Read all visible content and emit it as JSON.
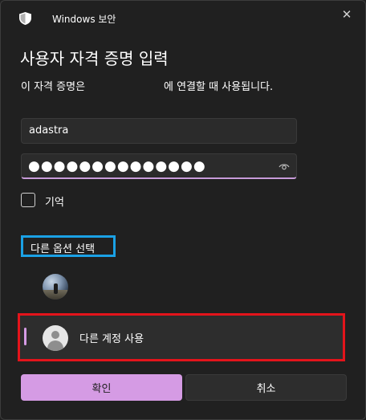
{
  "window": {
    "app_title": "Windows 보안",
    "icon": "shield-icon",
    "close_label": "✕"
  },
  "dialog": {
    "heading": "사용자 자격 증명 입력",
    "subtext_before": "이 자격 증명은",
    "subtext_after": "에 연결할 때 사용됩니다."
  },
  "form": {
    "username_value": "adastra",
    "password_mask": "●●●●●●●●●●●●●●",
    "password_reveal_icon": "eye-icon",
    "remember_label": "기억",
    "remember_checked": false
  },
  "options": {
    "more_choices_label": "다른 옵션 선택",
    "account_avatar_icon": "user-photo-icon",
    "other_account_label": "다른 계정 사용",
    "other_account_icon": "person-icon"
  },
  "buttons": {
    "ok_label": "확인",
    "cancel_label": "취소"
  },
  "colors": {
    "background": "#202020",
    "accent": "#d59be4",
    "highlight_blue": "#1aa1e5",
    "highlight_red": "#e3141b"
  }
}
